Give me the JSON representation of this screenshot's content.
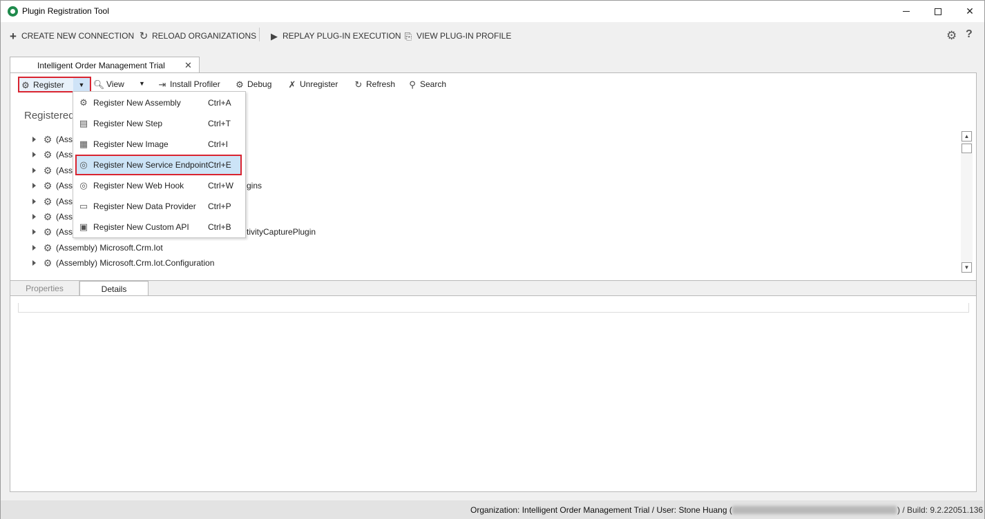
{
  "window": {
    "title": "Plugin Registration Tool"
  },
  "main_toolbar": {
    "create_connection": "CREATE NEW CONNECTION",
    "reload_organizations": "RELOAD ORGANIZATIONS",
    "replay_execution": "REPLAY PLUG-IN EXECUTION",
    "view_profile": "VIEW PLUG-IN PROFILE"
  },
  "doc_tab": {
    "label": "Intelligent Order Management Trial",
    "close": "✕"
  },
  "sub_toolbar": {
    "register": "Register",
    "view": "View",
    "install_profiler": "Install Profiler",
    "debug": "Debug",
    "unregister": "Unregister",
    "refresh": "Refresh",
    "search": "Search"
  },
  "registered_heading": "Registered",
  "tree": {
    "items": [
      {
        "label": "(Ass",
        "tail": ""
      },
      {
        "label": "(Ass",
        "tail": ""
      },
      {
        "label": "(Ass",
        "tail": ""
      },
      {
        "label": "(Ass",
        "tail": "gins"
      },
      {
        "label": "(Ass",
        "tail": ""
      },
      {
        "label": "(Ass",
        "tail": ""
      },
      {
        "label": "(Ass",
        "tail": "tivityCapturePlugin"
      },
      {
        "label": "(Assembly) Microsoft.Crm.Iot",
        "tail": ""
      },
      {
        "label": "(Assembly) Microsoft.Crm.Iot.Configuration",
        "tail": ""
      }
    ]
  },
  "register_menu": {
    "items": [
      {
        "label": "Register New Assembly",
        "shortcut": "Ctrl+A",
        "icon": "assembly-icon"
      },
      {
        "label": "Register New Step",
        "shortcut": "Ctrl+T",
        "icon": "step-icon"
      },
      {
        "label": "Register New Image",
        "shortcut": "Ctrl+I",
        "icon": "image-icon"
      },
      {
        "label": "Register New Service Endpoint",
        "shortcut": "Ctrl+E",
        "icon": "service-endpoint-icon"
      },
      {
        "label": "Register New Web Hook",
        "shortcut": "Ctrl+W",
        "icon": "web-hook-icon"
      },
      {
        "label": "Register New Data Provider",
        "shortcut": "Ctrl+P",
        "icon": "data-provider-icon"
      },
      {
        "label": "Register New Custom API",
        "shortcut": "Ctrl+B",
        "icon": "custom-api-icon"
      }
    ],
    "highlighted_index": 3
  },
  "bottom_tabs": {
    "properties": "Properties",
    "details": "Details"
  },
  "status": {
    "text": "Organization: Intelligent Order Management Trial / User: Stone Huang (",
    "build": ") / Build: 9.2.22051.136"
  },
  "colors": {
    "highlight_border": "#d9232f",
    "menu_highlight": "#cce4f7",
    "app_icon": "#1f8a4c"
  }
}
